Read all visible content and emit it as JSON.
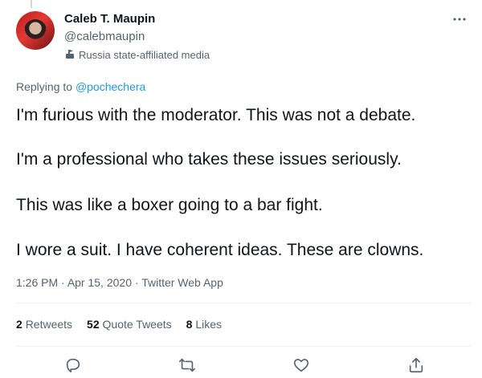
{
  "author": {
    "name": "Caleb T. Maupin",
    "handle": "@calebmaupin",
    "label": "Russia state-affiliated media"
  },
  "reply": {
    "prefix": "Replying to ",
    "to": "@pochechera"
  },
  "tweet": {
    "paragraphs": [
      "I'm furious with the moderator. This was not a debate.",
      "I'm a professional who takes these issues seriously.",
      "This was like a boxer going to a bar fight.",
      "I wore a suit. I have coherent ideas. These are clowns."
    ]
  },
  "meta": {
    "time": "1:26 PM",
    "sep1": " · ",
    "date": "Apr 15, 2020",
    "sep2": " · ",
    "source": "Twitter Web App"
  },
  "stats": {
    "retweets_count": "2",
    "retweets_label": "Retweets",
    "quotes_count": "52",
    "quotes_label": "Quote Tweets",
    "likes_count": "8",
    "likes_label": "Likes"
  },
  "icons": {
    "more": "more-icon",
    "affiliation": "podium-icon",
    "reply": "reply-icon",
    "retweet": "retweet-icon",
    "like": "like-icon",
    "share": "share-icon"
  },
  "colors": {
    "link": "#1d9bf0",
    "secondary": "#536471",
    "text": "#0f1419"
  }
}
